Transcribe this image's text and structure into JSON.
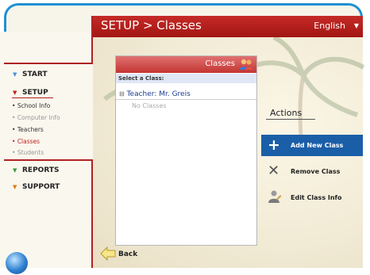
{
  "header": {
    "title": "SETUP > Classes",
    "language": "English"
  },
  "nav": {
    "start": "START",
    "setup": "SETUP",
    "setup_items": [
      "School Info",
      "Computer Info",
      "Teachers",
      "Classes",
      "Students"
    ],
    "reports": "REPORTS",
    "support": "SUPPORT"
  },
  "panel": {
    "title": "Classes",
    "select_label": "Select a Class:",
    "teacher": "Teacher: Mr. Greis",
    "empty": "No Classes"
  },
  "actions": {
    "title": "Actions",
    "add": "Add New Class",
    "remove": "Remove Class",
    "edit": "Edit Class Info"
  },
  "back": "Back",
  "colors": {
    "accent_red": "#c0211e",
    "selection_blue": "#1b5ea8",
    "frame_blue": "#1e90d2"
  }
}
